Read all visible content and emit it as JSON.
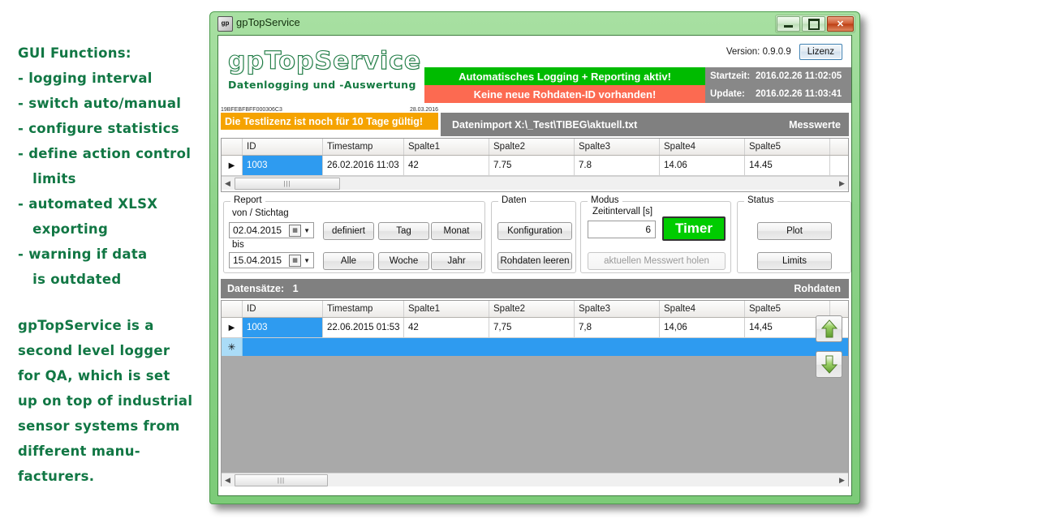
{
  "annotations": {
    "heading": "GUI Functions:",
    "bullets": [
      "- logging interval",
      "- switch auto/manual",
      "- configure statistics",
      "- define action control",
      "   limits",
      "- automated XLSX",
      "   exporting",
      "- warning if data",
      "   is outdated"
    ],
    "paragraph": [
      "gpTopService is a",
      "second level logger",
      "for QA, which is set",
      "up on top of industrial",
      "sensor systems from",
      "different manu-",
      "facturers."
    ]
  },
  "window": {
    "title": "gpTopService",
    "icon": "app-icon",
    "minimize_label": "",
    "maximize_label": "",
    "close_label": "✕"
  },
  "header": {
    "logo_title": "gpTopService",
    "logo_subtitle": "Datenlogging und -Auswertung",
    "version_label": "Version: 0.9.0.9",
    "license_button": "Lizenz",
    "banner_green": "Automatisches Logging + Reporting aktiv!",
    "banner_red": "Keine neue Rohdaten-ID vorhanden!",
    "info": {
      "start_key": "Startzeit:",
      "start_value": "2016.02.26 11:02:05",
      "update_key": "Update:",
      "update_value": "2016.02.26 11:03:41"
    },
    "serial": "19BFEBFBFF000306C3",
    "serial_date": "28.03.2016",
    "license_bar": "Die Testlizenz ist noch für 10 Tage gültig!",
    "import_path": "Datenimport X:\\_Test\\TIBEG\\aktuell.txt",
    "import_caption": "Messwerte"
  },
  "messwerte_grid": {
    "columns": [
      "ID",
      "Timestamp",
      "Spalte1",
      "Spalte2",
      "Spalte3",
      "Spalte4",
      "Spalte5"
    ],
    "rows": [
      {
        "marker": "▶",
        "cells": [
          "1003",
          "26.02.2016 11:03",
          "42",
          "7.75",
          "7.8",
          "14.06",
          "14.45"
        ]
      }
    ]
  },
  "report": {
    "title": "Report",
    "from_label": "von / Stichtag",
    "from_value": "02.04.2015",
    "to_label": "bis",
    "to_value": "15.04.2015",
    "buttons": [
      "definiert",
      "Tag",
      "Monat",
      "Alle",
      "Woche",
      "Jahr"
    ]
  },
  "daten": {
    "title": "Daten",
    "buttons": [
      "Konfiguration",
      "Rohdaten leeren"
    ]
  },
  "modus": {
    "title": "Modus",
    "interval_label": "Zeitintervall [s]",
    "interval_value": "6",
    "timer_button": "Timer",
    "fetch_button": "aktuellen Messwert holen"
  },
  "status": {
    "title": "Status",
    "buttons": [
      "Plot",
      "Limits"
    ]
  },
  "rohdaten": {
    "count_label": "Datensätze:",
    "count_value": "1",
    "caption": "Rohdaten",
    "columns": [
      "ID",
      "Timestamp",
      "Spalte1",
      "Spalte2",
      "Spalte3",
      "Spalte4",
      "Spalte5"
    ],
    "rows": [
      {
        "marker": "▶",
        "cells": [
          "1003",
          "22.06.2015 01:53",
          "42",
          "7,75",
          "7,8",
          "14,06",
          "14,45"
        ]
      }
    ],
    "new_row_marker": "✳"
  },
  "navigation": {
    "up_label": "up-arrow",
    "down_label": "down-arrow"
  },
  "colors": {
    "accent_green": "#00bb00",
    "warn_red": "#fc6a51",
    "license_orange": "#f5a300",
    "bar_grey": "#808080",
    "select_blue": "#2e9bf0",
    "window_green": "#7ed07e",
    "annotation_green": "#117744"
  }
}
